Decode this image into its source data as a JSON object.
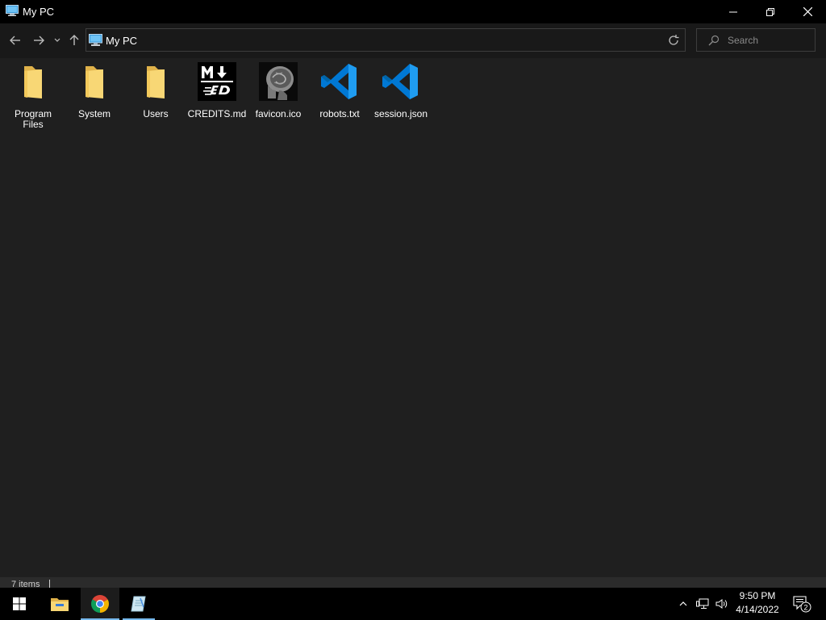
{
  "window": {
    "title": "My PC",
    "minimize_icon": "minimize-icon",
    "restore_icon": "restore-icon",
    "close_icon": "close-icon"
  },
  "nav": {
    "back_icon": "arrow-left-icon",
    "forward_icon": "arrow-right-icon",
    "recent_icon": "chevron-down-icon",
    "up_icon": "arrow-up-icon"
  },
  "address": {
    "location": "My PC",
    "icon": "computer-icon",
    "refresh_icon": "refresh-icon"
  },
  "search": {
    "placeholder": "Search",
    "value": ""
  },
  "items": [
    {
      "label": "Program Files",
      "type": "folder"
    },
    {
      "label": "System",
      "type": "folder"
    },
    {
      "label": "Users",
      "type": "folder"
    },
    {
      "label": "CREDITS.md",
      "type": "markdown-file"
    },
    {
      "label": "favicon.ico",
      "type": "image-file"
    },
    {
      "label": "robots.txt",
      "type": "vscode-file"
    },
    {
      "label": "session.json",
      "type": "vscode-file"
    }
  ],
  "status": {
    "item_count": "7 items"
  },
  "taskbar": {
    "apps": [
      "start-icon",
      "file-explorer-icon",
      "chrome-icon",
      "notepad-icon"
    ],
    "clock_time": "9:50 PM",
    "clock_date": "4/14/2022",
    "notification_count": "2"
  },
  "colors": {
    "background": "#1f1f1f",
    "titlebar": "#000000",
    "folder": "#f8d775",
    "vscode": "#0078d4",
    "taskbar_accent": "#76b9ed"
  }
}
